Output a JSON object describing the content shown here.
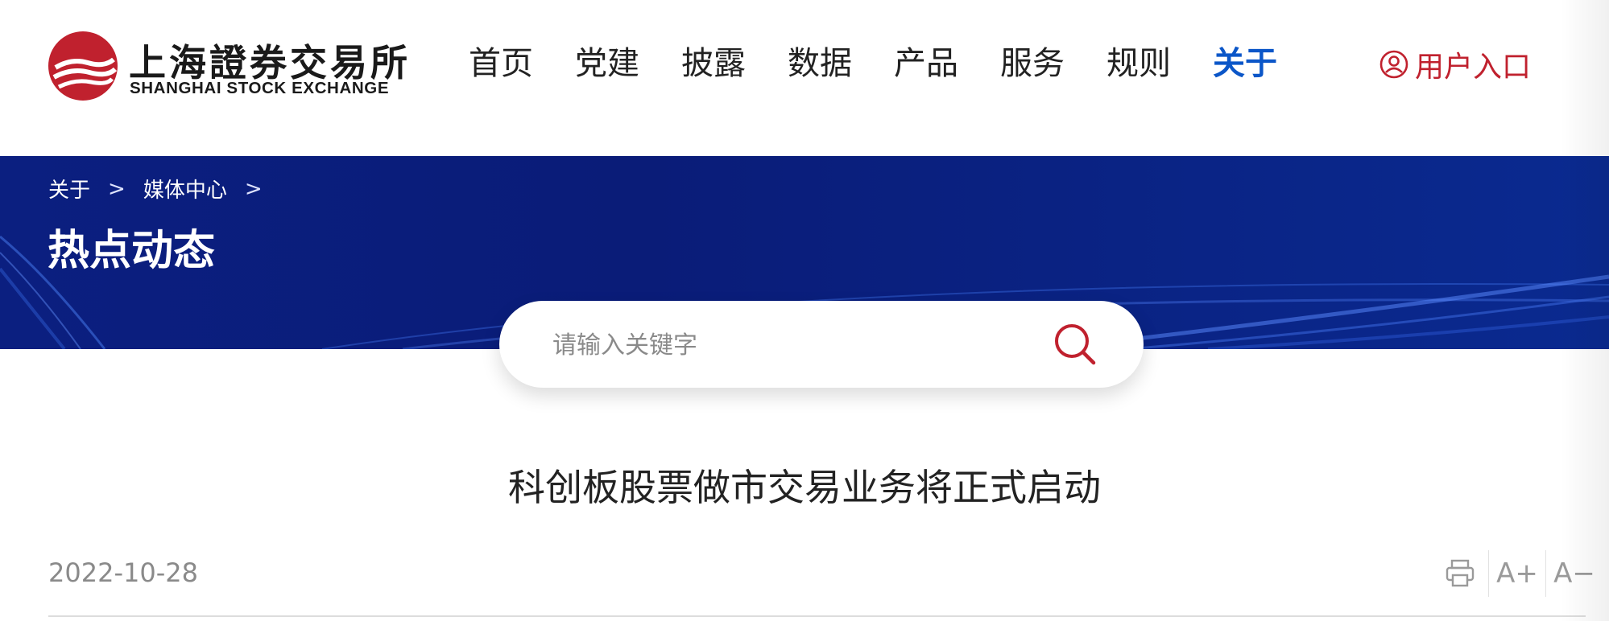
{
  "header": {
    "logo_cn": "上海證券交易所",
    "logo_en": "SHANGHAI STOCK EXCHANGE",
    "nav": [
      "首页",
      "党建",
      "披露",
      "数据",
      "产品",
      "服务",
      "规则",
      "关于"
    ],
    "active_nav": "关于",
    "user_entry": "用户入口"
  },
  "banner": {
    "breadcrumb": [
      "关于",
      "媒体中心"
    ],
    "title": "热点动态"
  },
  "search": {
    "placeholder": "请输入关键字"
  },
  "article": {
    "title": "科创板股票做市交易业务将正式启动",
    "date": "2022-10-28"
  },
  "tools": {
    "font_increase": "A+",
    "font_decrease": "A−"
  },
  "colors": {
    "brand_red": "#c0212e",
    "active_blue": "#0b56c8",
    "banner_navy": "#0a1c78"
  }
}
